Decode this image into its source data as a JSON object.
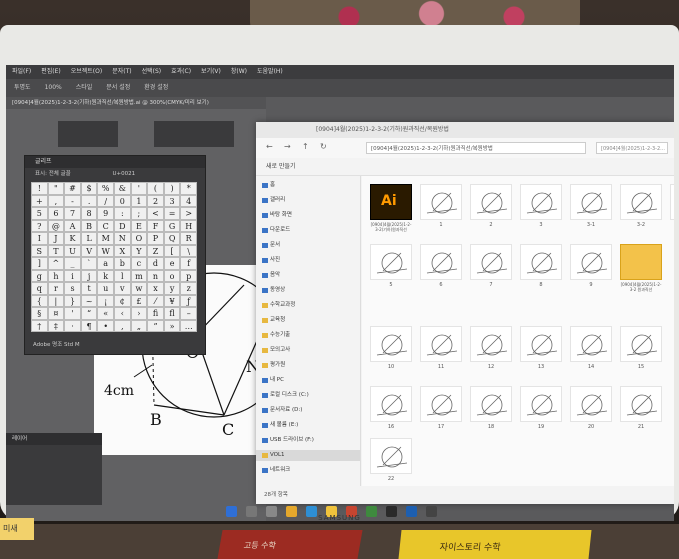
{
  "monitor": {
    "brand": "SAMSUNG"
  },
  "illustrator": {
    "menu": [
      "파일(F)",
      "편집(E)",
      "오브젝트(O)",
      "문자(T)",
      "선택(S)",
      "효과(C)",
      "보기(V)",
      "창(W)",
      "도움말(H)"
    ],
    "controls": [
      "투명도",
      "100%",
      "스타일",
      "문서 설정",
      "환경 설정"
    ],
    "doc_tab": "[0904]4월(2025)1-2-3-2(기하)원과직선/복원방법.ai @ 300%(CMYK/미리 보기)",
    "glyphs_panel": {
      "title": "글리프",
      "show_label": "표시: 전체 글꼴",
      "unicode": "U+0021",
      "font": "Adobe 명조 Std M",
      "glyphs": [
        "!",
        "\"",
        "#",
        "$",
        "%",
        "&",
        "'",
        "(",
        ")",
        "*",
        "+",
        ",",
        "-",
        ".",
        "/",
        "0",
        "1",
        "2",
        "3",
        "4",
        "5",
        "6",
        "7",
        "8",
        "9",
        ":",
        ";",
        "<",
        "=",
        ">",
        "?",
        "@",
        "A",
        "B",
        "C",
        "D",
        "E",
        "F",
        "G",
        "H",
        "I",
        "J",
        "K",
        "L",
        "M",
        "N",
        "O",
        "P",
        "Q",
        "R",
        "S",
        "T",
        "U",
        "V",
        "W",
        "X",
        "Y",
        "Z",
        "[",
        "\\",
        "]",
        "^",
        "_",
        "`",
        "a",
        "b",
        "c",
        "d",
        "e",
        "f",
        "g",
        "h",
        "i",
        "j",
        "k",
        "l",
        "m",
        "n",
        "o",
        "p",
        "q",
        "r",
        "s",
        "t",
        "u",
        "v",
        "w",
        "x",
        "y",
        "z",
        "{",
        "|",
        "}",
        "~",
        "¡",
        "¢",
        "£",
        "⁄",
        "¥",
        "ƒ",
        "§",
        "¤",
        "'",
        "“",
        "«",
        "‹",
        "›",
        "ﬁ",
        "ﬂ",
        "–",
        "†",
        "‡",
        "·",
        "¶",
        "•",
        "‚",
        "„",
        "”",
        "»",
        "…"
      ]
    },
    "layers_title": "레이어",
    "artboard_labels": {
      "o": "O",
      "n": "N",
      "b": "B",
      "c": "C",
      "dim": "4cm"
    }
  },
  "explorer": {
    "title": "[0904]4월(2025)1-2-3-2(기하)원과직선/복원방법",
    "address": "[0904]4월(2025)1-2-3-2(기하)원과직선/복원방법",
    "search": "[0904]4월(2025)1-2-3-2...",
    "command_bar": "새로 만들기",
    "sidebar": [
      {
        "label": "홈",
        "kind": "blue"
      },
      {
        "label": "갤러리",
        "kind": "blue"
      },
      {
        "label": "바탕 화면",
        "kind": "blue"
      },
      {
        "label": "다운로드",
        "kind": "blue"
      },
      {
        "label": "문서",
        "kind": "blue"
      },
      {
        "label": "사진",
        "kind": "blue"
      },
      {
        "label": "음악",
        "kind": "blue"
      },
      {
        "label": "동영상",
        "kind": "blue"
      },
      {
        "label": "수학교과정",
        "kind": "folder"
      },
      {
        "label": "교육청",
        "kind": "folder"
      },
      {
        "label": "수능기출",
        "kind": "folder"
      },
      {
        "label": "모의고사",
        "kind": "folder"
      },
      {
        "label": "평가원",
        "kind": "folder"
      },
      {
        "label": "내 PC",
        "kind": "blue"
      },
      {
        "label": "로컬 디스크 (C:)",
        "kind": "blue"
      },
      {
        "label": "문서자료 (D:)",
        "kind": "blue"
      },
      {
        "label": "새 볼륨 (E:)",
        "kind": "blue"
      },
      {
        "label": "USB 드라이브 (F:)",
        "kind": "blue"
      },
      {
        "label": "VOL1",
        "kind": "folder",
        "selected": true
      },
      {
        "label": "네트워크",
        "kind": "blue"
      }
    ],
    "files": [
      {
        "label": "[0904]4월(2025)1-2-3-2(기하)원과직선",
        "kind": "ai"
      },
      {
        "label": "1",
        "kind": "shape"
      },
      {
        "label": "2",
        "kind": "shape"
      },
      {
        "label": "3",
        "kind": "shape"
      },
      {
        "label": "3-1",
        "kind": "shape"
      },
      {
        "label": "3-2",
        "kind": "shape"
      },
      {
        "label": "4",
        "kind": "shape"
      },
      {
        "label": "5",
        "kind": "shape"
      },
      {
        "label": "6",
        "kind": "shape"
      },
      {
        "label": "7",
        "kind": "shape"
      },
      {
        "label": "8",
        "kind": "shape"
      },
      {
        "label": "9",
        "kind": "shape"
      },
      {
        "label": "[0904]4월(2025)1-2-3-2 원과직선",
        "kind": "folder"
      },
      {
        "label": "10",
        "kind": "shape"
      },
      {
        "label": "11",
        "kind": "shape"
      },
      {
        "label": "12",
        "kind": "shape"
      },
      {
        "label": "13",
        "kind": "shape"
      },
      {
        "label": "14",
        "kind": "shape"
      },
      {
        "label": "15",
        "kind": "shape"
      },
      {
        "label": "16",
        "kind": "shape"
      },
      {
        "label": "17",
        "kind": "shape"
      },
      {
        "label": "18",
        "kind": "shape"
      },
      {
        "label": "19",
        "kind": "shape"
      },
      {
        "label": "20",
        "kind": "shape"
      },
      {
        "label": "21",
        "kind": "shape"
      },
      {
        "label": "22",
        "kind": "shape"
      }
    ],
    "status": "28개 항목"
  },
  "desk": {
    "book_red": "고등 수학",
    "book_yellow": "자이스토리 수학",
    "sticker": "미새"
  }
}
